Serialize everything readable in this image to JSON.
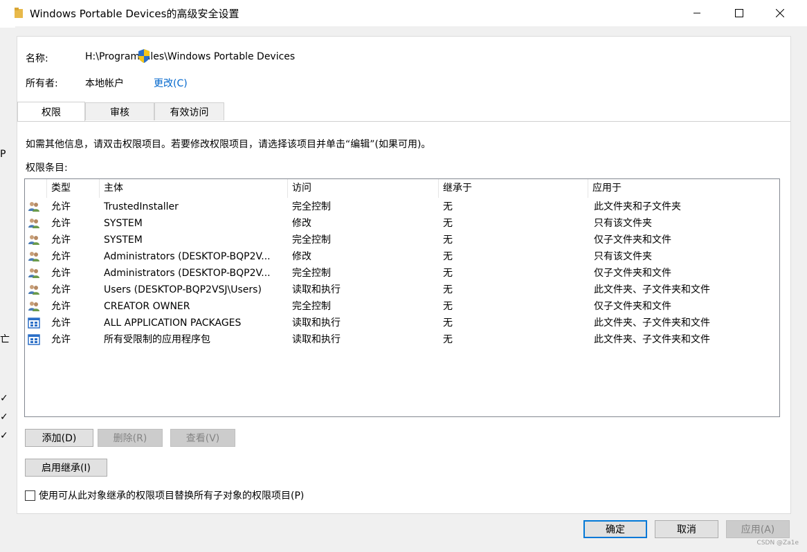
{
  "window": {
    "title": "Windows Portable Devices的高级安全设置"
  },
  "info": {
    "name_label": "名称:",
    "name_value": "H:\\Program Files\\Windows Portable Devices",
    "owner_label": "所有者:",
    "owner_value": "本地帐户",
    "change_link": "更改(C)"
  },
  "tabs": [
    {
      "label": "权限",
      "active": true
    },
    {
      "label": "审核",
      "active": false
    },
    {
      "label": "有效访问",
      "active": false
    }
  ],
  "instructions": "如需其他信息，请双击权限项目。若要修改权限项目，请选择该项目并单击“编辑”(如果可用)。",
  "entries_label": "权限条目:",
  "table": {
    "columns": [
      "类型",
      "主体",
      "访问",
      "继承于",
      "应用于"
    ],
    "rows": [
      {
        "icon": "users-icon",
        "type": "允许",
        "principal": "TrustedInstaller",
        "access": "完全控制",
        "inherited": "无",
        "applies": "此文件夹和子文件夹"
      },
      {
        "icon": "users-icon",
        "type": "允许",
        "principal": "SYSTEM",
        "access": "修改",
        "inherited": "无",
        "applies": "只有该文件夹"
      },
      {
        "icon": "users-icon",
        "type": "允许",
        "principal": "SYSTEM",
        "access": "完全控制",
        "inherited": "无",
        "applies": "仅子文件夹和文件"
      },
      {
        "icon": "users-icon",
        "type": "允许",
        "principal": "Administrators (DESKTOP-BQP2V...",
        "access": "修改",
        "inherited": "无",
        "applies": "只有该文件夹"
      },
      {
        "icon": "users-icon",
        "type": "允许",
        "principal": "Administrators (DESKTOP-BQP2V...",
        "access": "完全控制",
        "inherited": "无",
        "applies": "仅子文件夹和文件"
      },
      {
        "icon": "users-icon",
        "type": "允许",
        "principal": "Users (DESKTOP-BQP2VSJ\\Users)",
        "access": "读取和执行",
        "inherited": "无",
        "applies": "此文件夹、子文件夹和文件"
      },
      {
        "icon": "users-icon",
        "type": "允许",
        "principal": "CREATOR OWNER",
        "access": "完全控制",
        "inherited": "无",
        "applies": "仅子文件夹和文件"
      },
      {
        "icon": "app-package-icon",
        "type": "允许",
        "principal": "ALL APPLICATION PACKAGES",
        "access": "读取和执行",
        "inherited": "无",
        "applies": "此文件夹、子文件夹和文件"
      },
      {
        "icon": "app-package-icon",
        "type": "允许",
        "principal": "所有受限制的应用程序包",
        "access": "读取和执行",
        "inherited": "无",
        "applies": "此文件夹、子文件夹和文件"
      }
    ]
  },
  "buttons": {
    "add": "添加(D)",
    "remove": "删除(R)",
    "view": "查看(V)",
    "enable_inheritance": "启用继承(I)",
    "ok": "确定",
    "cancel": "取消",
    "apply": "应用(A)"
  },
  "replace_checkbox": {
    "label": "使用可从此对象继承的权限项目替换所有子对象的权限项目(P)",
    "checked": false
  },
  "watermark": "CSDN @Za1e"
}
